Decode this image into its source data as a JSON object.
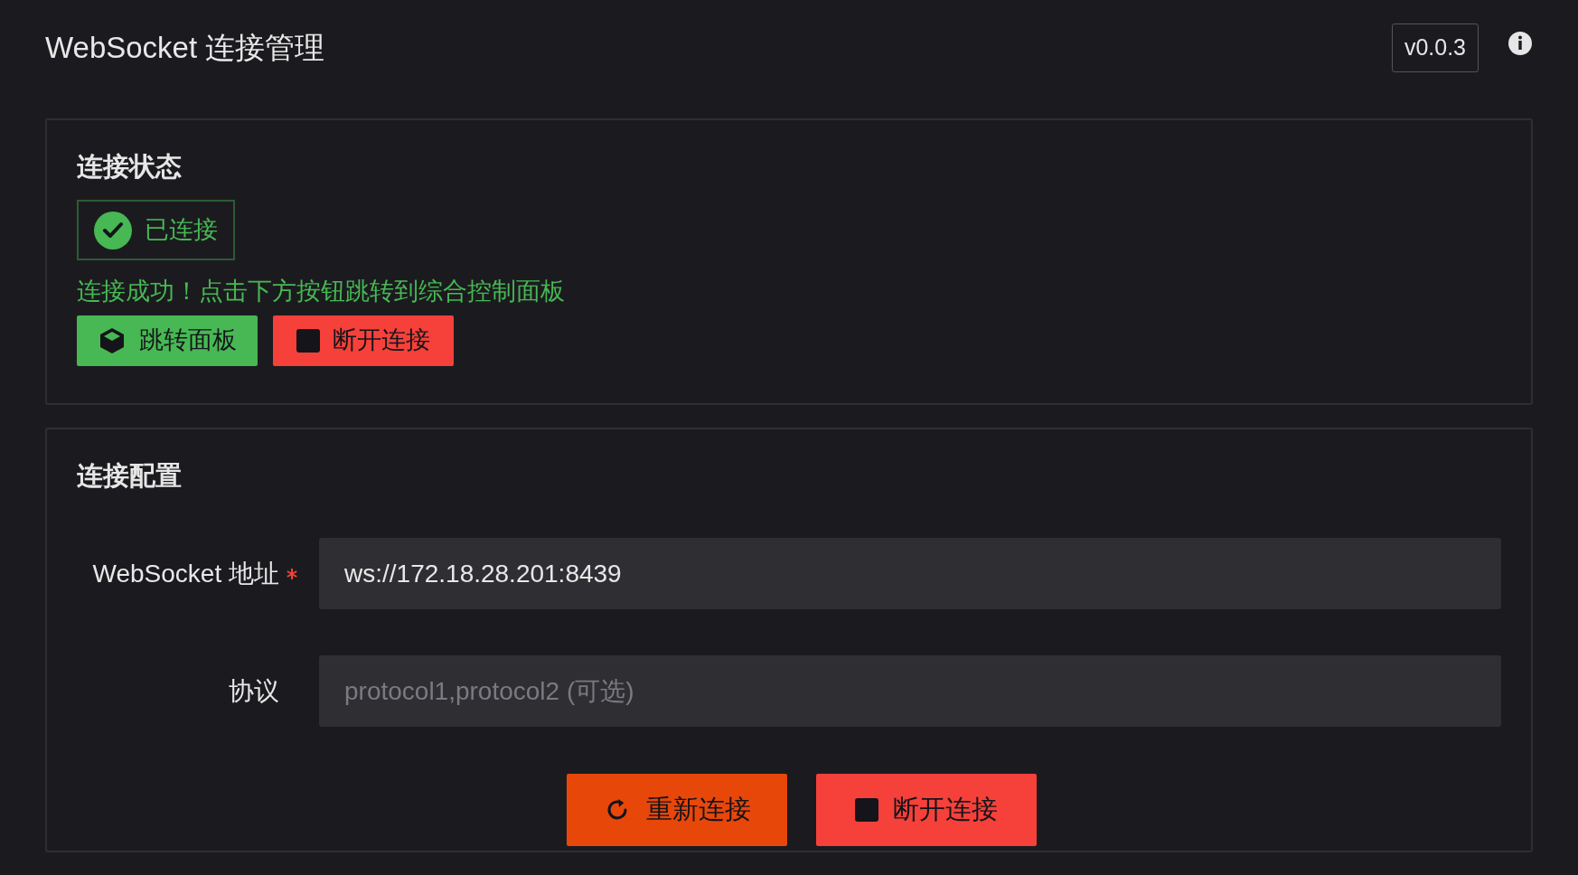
{
  "header": {
    "title": "WebSocket 连接管理",
    "version": "v0.0.3"
  },
  "status_card": {
    "heading": "连接状态",
    "status": {
      "label": "已连接",
      "connected": true
    },
    "message": "连接成功！点击下方按钮跳转到综合控制面板",
    "buttons": [
      {
        "kind": "dashboard",
        "label": "跳转面板"
      },
      {
        "kind": "disconnect",
        "label": "断开连接"
      }
    ]
  },
  "config_card": {
    "heading": "连接配置",
    "fields": [
      {
        "label": "WebSocket 地址",
        "required": true,
        "value": "ws://172.18.28.201:8439"
      },
      {
        "label": "协议",
        "required": false,
        "placeholder": "protocol1,protocol2 (可选)"
      }
    ],
    "buttons": [
      {
        "kind": "reconnect",
        "label": "重新连接"
      },
      {
        "kind": "disconnect",
        "label": "断开连接"
      }
    ]
  }
}
